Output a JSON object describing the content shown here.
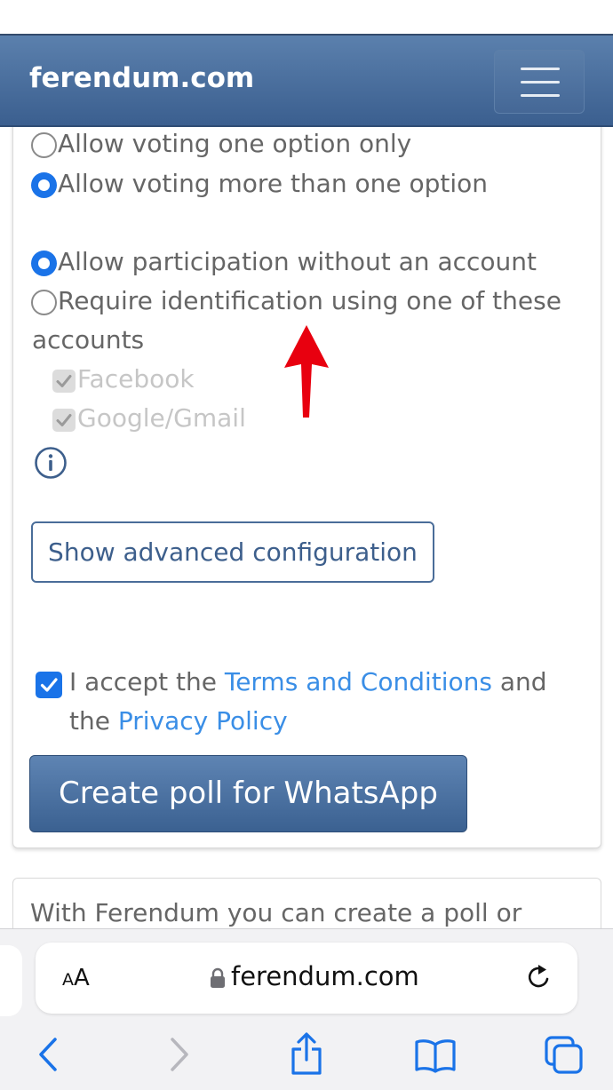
{
  "header": {
    "brand": "ferendum.com",
    "menu_icon": "hamburger-menu-icon"
  },
  "options": {
    "voting_one": "Allow voting one option only",
    "voting_multiple": "Allow voting more than one option",
    "participation_no_account": "Allow participation without an account",
    "require_id_line1": "Require identification using one of these",
    "require_id_line2": "accounts",
    "facebook": "Facebook",
    "google": "Google/Gmail",
    "selected_voting": "voting_multiple",
    "selected_participation": "participation_no_account",
    "facebook_checked": true,
    "google_checked": true
  },
  "advanced_button": "Show advanced configuration",
  "terms": {
    "accepted": true,
    "text1": "I accept the ",
    "terms_link": "Terms and Conditions",
    "text2": " and",
    "text3": "the ",
    "privacy_link": "Privacy Policy"
  },
  "create_button": "Create poll for WhatsApp",
  "info_text": "With Ferendum you can create a poll or",
  "annotation_color": "#e8000f",
  "browser": {
    "text_size_label_small": "A",
    "text_size_label_large": "A",
    "url": "ferendum.com",
    "icons": [
      "back-icon",
      "forward-icon",
      "share-icon",
      "bookmarks-icon",
      "tabs-icon"
    ]
  },
  "colors": {
    "navbar": "#4a6e9c",
    "accent_blue": "#1a73e8",
    "link": "#3a8ee6"
  }
}
